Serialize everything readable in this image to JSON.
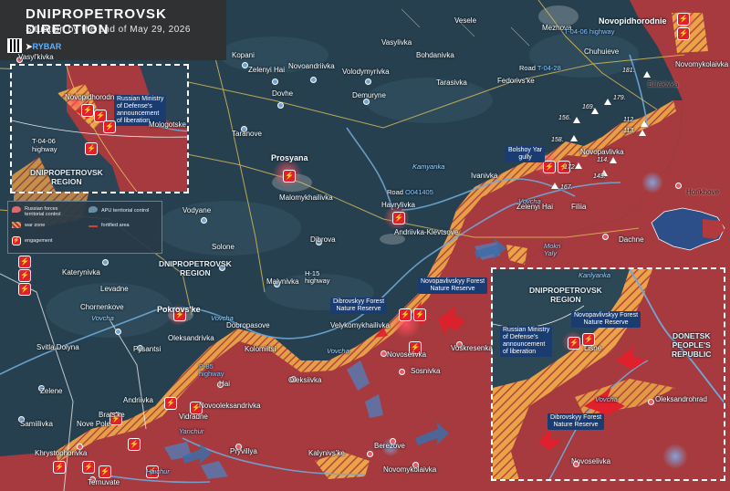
{
  "header": {
    "title": "DNIPROPETROVSK DIRECTION",
    "subtitle": "Situation by the end of May 29, 2026",
    "brand_prefix": "",
    "brand": "RYBAR",
    "brand_icon": "telegram-arrow-icon"
  },
  "colors": {
    "russian_territory": "#a63a3e",
    "war_zone": "#e9a447",
    "apu_territory": "#2c4756",
    "engagement": "#e0202c",
    "river": "#6fa8d8"
  },
  "legend": {
    "russian_forces": "Russian forces territorial control",
    "apu": "APU territorial control",
    "war_zone": "war zone",
    "fortified": "fortified area",
    "engagement": "engagement"
  },
  "settlements": {
    "vasylkivka_top": "Vasyl'kivka",
    "kopani": "Kopani",
    "zelenyi_hai_top": "Zelenyi Hai",
    "novoandriivka": "Novoandriivka",
    "volodymyrivka": "Volodymyrivka",
    "bohdanivka": "Bohdanivka",
    "vesele": "Vesele",
    "mezhova": "Mezhova",
    "novopidhorodnie": "Novopidhorodnie",
    "vasylivka": "Vasylivka",
    "chuhuieve": "Chuhuieve",
    "novomykolaivka_top": "Novomykolaivka",
    "dovhe": "Dovhe",
    "demuryne": "Demuryne",
    "tarasivka": "Tarasivka",
    "fedorivske": "Fedorivs'ke",
    "biliakivka": "Biliakivka",
    "taranove": "Taranove",
    "prosyana": "Prosyana",
    "malomykhailivka": "Malomykhailivka",
    "ivanivka": "Ivanivka",
    "novopavlivka": "Novopavlivka",
    "horikhove": "Horikhove",
    "vodyane": "Vodyane",
    "havrylivka": "Havrylivka",
    "zelenyi_hai_mid": "Zelenyi Hai",
    "filiia": "Filiia",
    "solone": "Solone",
    "dibrova": "Dibrova",
    "andriivka_klevtsove": "Andriivka-Klevtsove",
    "dachne": "Dachne",
    "katerynivka": "Katerynivka",
    "levadne": "Levadne",
    "malynivka": "Malynivka",
    "chornenkove": "Chornenkove",
    "pokrovske": "Pokrovs'ke",
    "dobropasove": "Dobropasove",
    "velykomykhailivka": "Velykomykhailivka",
    "sviltla_dolyna": "Svitla Dolyna",
    "pysantsi": "Pysantsi",
    "oleksandrivka": "Oleksandrivka",
    "kolomiitsi": "Kolomiitsi",
    "novoselivka": "Novoselivka",
    "voskresenka": "Voskresenka",
    "sosnivka": "Sosnivka",
    "oleksiivka": "Oleksiivka",
    "zelene": "Zelene",
    "andriivka": "Andriivka",
    "hai": "Hai",
    "novooleksandrivka": "Novooleksandrivka",
    "bratske": "Brats'ke",
    "vidradne": "Vidradne",
    "samiilivka": "Samiilivka",
    "nove_pole": "Nove Pole",
    "khrystophorivka": "Khrystophorivka",
    "pryvillya": "Pryvillya",
    "kalynivske": "Kalynivs'ke",
    "berezove": "Berezove",
    "novomykolaivka_bot": "Novomykolaivka",
    "ternuvate": "Ternuvate"
  },
  "regions": {
    "dnipro_inset": "DNIPROPETROVSK\nREGION",
    "dnipro_main": "DNIPROPETROVSK\nREGION",
    "dnipro_inset2": "DNIPROPETROVSK\nREGION",
    "donetsk": "DONETSK\nPEOPLE'S\nREPUBLIC"
  },
  "rivers": {
    "vovcha_1": "Vovcha",
    "vovcha_2": "Vovcha",
    "vovcha_3": "Vovcha",
    "vovcha_4": "Vovcha",
    "yanchur": "Yanchur",
    "haichur": "Haichur",
    "kamianka": "Kamyanka",
    "mokri_yaly": "Mokri\nYaly",
    "vovcha_inset": "Vovcha",
    "karilyanka": "Karilyanka"
  },
  "roads": {
    "t0406_top": "T-04-06 highway",
    "t0428_prefix": "Road",
    "t0428": "T-04-28",
    "o041405_prefix": "Road",
    "o041405": "O041405",
    "h15": "H-15\nhighway",
    "p85": "P-85\nhighway",
    "t0406_inset": "T-04-06\nhighway"
  },
  "tags": {
    "bolshoy_yar": "Bolshoy Yar\ngully",
    "novopavlivskyy": "Novopavlivskyy Forest\nNature Reserve",
    "dibrovskyy": "Dibrovskyy Forest\nNature Reserve"
  },
  "heights": [
    "181.",
    "179.",
    "169.",
    "156.",
    "158.",
    "112.",
    "113.",
    "172.",
    "114.",
    "143.",
    "167."
  ],
  "inset1": {
    "novopidhorodne": "Novopidhorodne",
    "mologotske": "Mologotske",
    "mod_text": "Russian Ministry\nof Defense's\nannouncement\nof liberation",
    "road": "T-04-06\nhighway",
    "region": "DNIPROPETROVSK\nREGION"
  },
  "inset2": {
    "region": "DNIPROPETROVSK\nREGION",
    "novopavlivskyy": "Novopavlivskyy Forest\nNature Reserve",
    "mod_text": "Russian Ministry\nof Defense's\nannouncement\nof liberation",
    "lisne": "Lisne",
    "donetsk": "DONETSK\nPEOPLE'S\nREPUBLIC",
    "oleksandrohrad": "Oleksandrohrad",
    "dibrovskyy": "Dibrovskyy Forest\nNature Reserve",
    "novoselivka": "Novoselivka",
    "vovcha": "Vovcha",
    "karilyanka": "Karilyanka"
  }
}
